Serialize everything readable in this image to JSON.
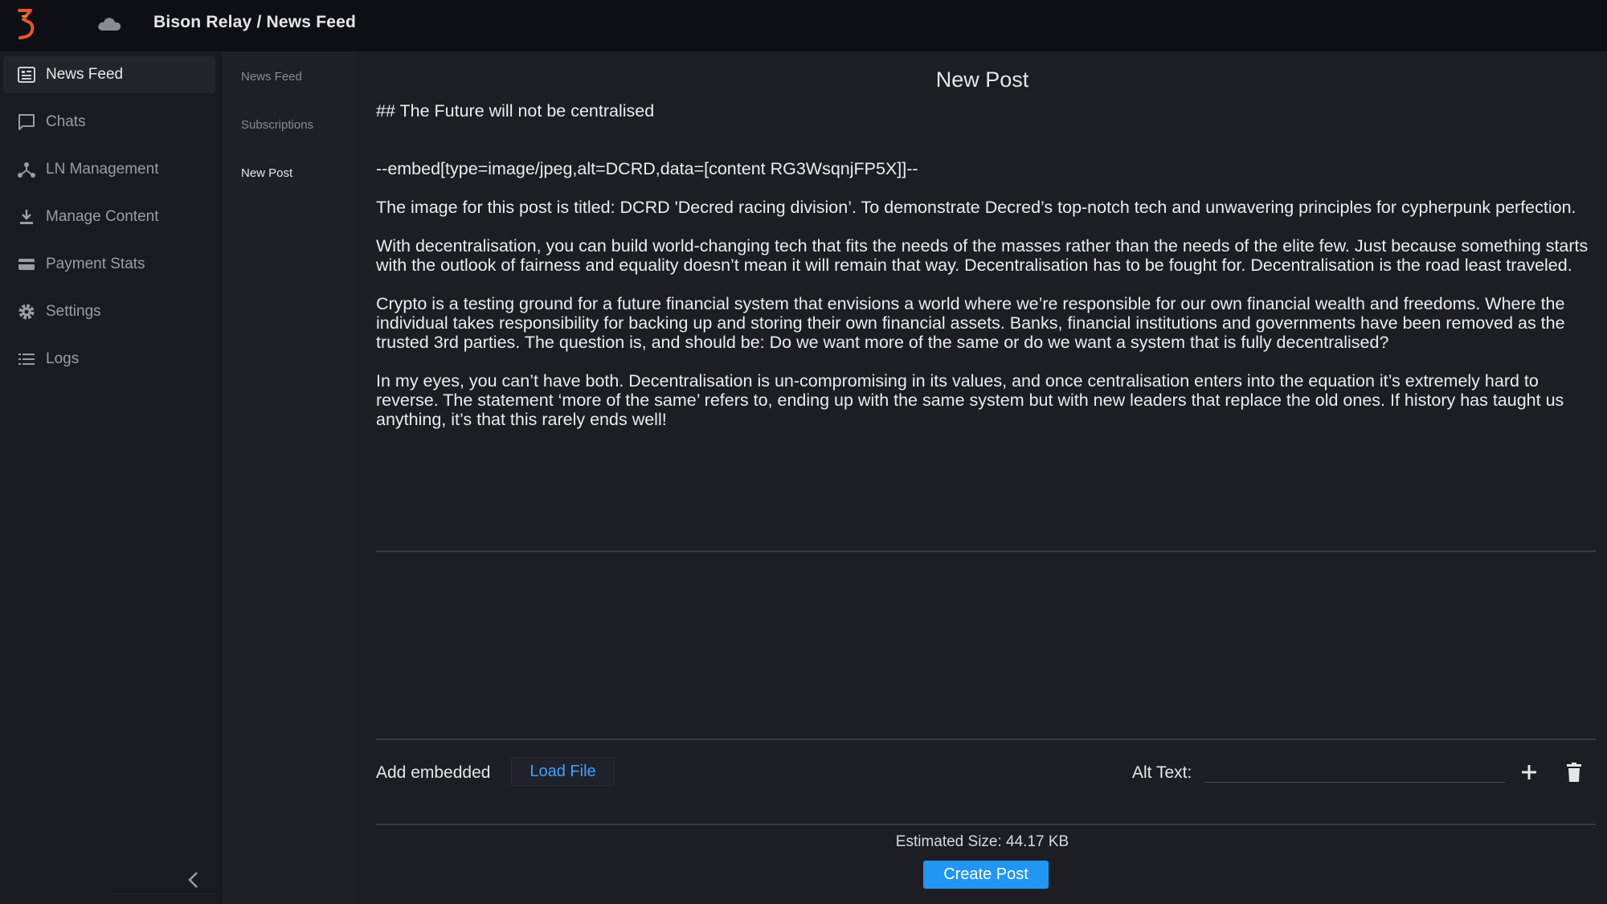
{
  "header": {
    "title": "Bison Relay / News Feed"
  },
  "sidebar": {
    "items": [
      {
        "label": "News Feed",
        "icon": "newspaper-icon",
        "active": true
      },
      {
        "label": "Chats",
        "icon": "chat-bubble-icon",
        "active": false
      },
      {
        "label": "LN Management",
        "icon": "network-icon",
        "active": false
      },
      {
        "label": "Manage Content",
        "icon": "download-icon",
        "active": false
      },
      {
        "label": "Payment Stats",
        "icon": "card-icon",
        "active": false
      },
      {
        "label": "Settings",
        "icon": "gear-icon",
        "active": false
      },
      {
        "label": "Logs",
        "icon": "list-icon",
        "active": false
      }
    ]
  },
  "subnav": {
    "items": [
      {
        "label": "News Feed",
        "active": false
      },
      {
        "label": "Subscriptions",
        "active": false
      },
      {
        "label": "New Post",
        "active": true
      }
    ]
  },
  "main": {
    "title": "New Post",
    "post": {
      "heading": "## The Future will not be centralised",
      "embed": "--embed[type=image/jpeg,alt=DCRD,data=[content RG3WsqnjFP5X]]--",
      "p1": "The image for this post is titled: DCRD 'Decred racing division’. To demonstrate Decred’s top-notch tech and unwavering principles for cypherpunk perfection.",
      "p2": "With decentralisation, you can build world-changing tech that fits the needs of the masses rather than the needs of the elite few. Just because something starts with the outlook of fairness and equality doesn’t mean it will remain that way. Decentralisation has to be fought for. Decentralisation is the road least traveled.",
      "p3": "Crypto is a testing ground for a future financial system that envisions a world where we’re responsible for our own financial wealth and freedoms. Where the individual takes responsibility for backing up and storing their own financial assets. Banks, financial institutions and governments have been removed as the trusted 3rd parties. The question is, and should be: Do we want more of the same or do we want a system that is fully decentralised?",
      "p4": "In my eyes, you can’t have both. Decentralisation is un-compromising in its values, and once centralisation enters into the equation it’s extremely hard to reverse. The statement ‘more of the same’ refers to, ending up with the same system but with new leaders that replace the old ones. If history has taught us anything, it’s that this rarely ends well!"
    },
    "embed_controls": {
      "add_embedded_label": "Add embedded",
      "load_file_label": "Load File",
      "alt_text_label": "Alt Text:",
      "alt_text_value": ""
    },
    "estimated_size": "Estimated Size: 44.17 KB",
    "create_post_label": "Create Post"
  },
  "colors": {
    "accent": "#2196f3",
    "link": "#3fa2ff",
    "logo": "#e8572a"
  }
}
